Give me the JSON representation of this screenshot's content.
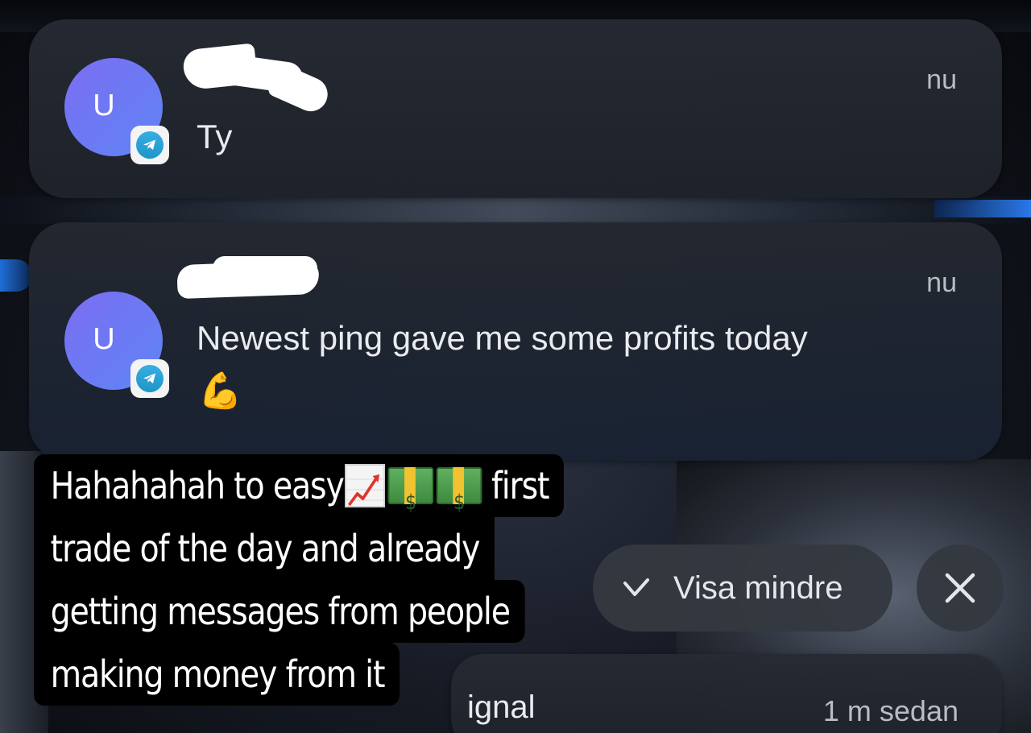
{
  "notifications": [
    {
      "avatar_letter": "U",
      "badge_icon": "telegram-icon",
      "sender": "",
      "message": "Ty",
      "time": "nu"
    },
    {
      "avatar_letter": "U",
      "badge_icon": "telegram-icon",
      "sender": "",
      "message": "Newest ping gave me some profits today",
      "emoji": "💪",
      "time": "nu"
    },
    {
      "partial_text": "ignal",
      "time": "1 m sedan"
    }
  ],
  "overlay_text": {
    "line1_before": "Hahahahah to easy",
    "line1_after": "first",
    "line2": "trade of the day and already",
    "line3": "getting messages from people",
    "line4": "making money from it",
    "emojis": [
      "chart-increasing-emoji",
      "money-emoji",
      "money-emoji"
    ],
    "money_symbol": "$"
  },
  "controls": {
    "show_less_label": "Visa mindre",
    "show_less_icon": "chevron-up-icon",
    "close_icon": "close-icon"
  },
  "colors": {
    "avatar": "#6f79f3",
    "telegram": "#2aa3dd",
    "card": "#262a32",
    "overlay_bg": "#000000"
  }
}
